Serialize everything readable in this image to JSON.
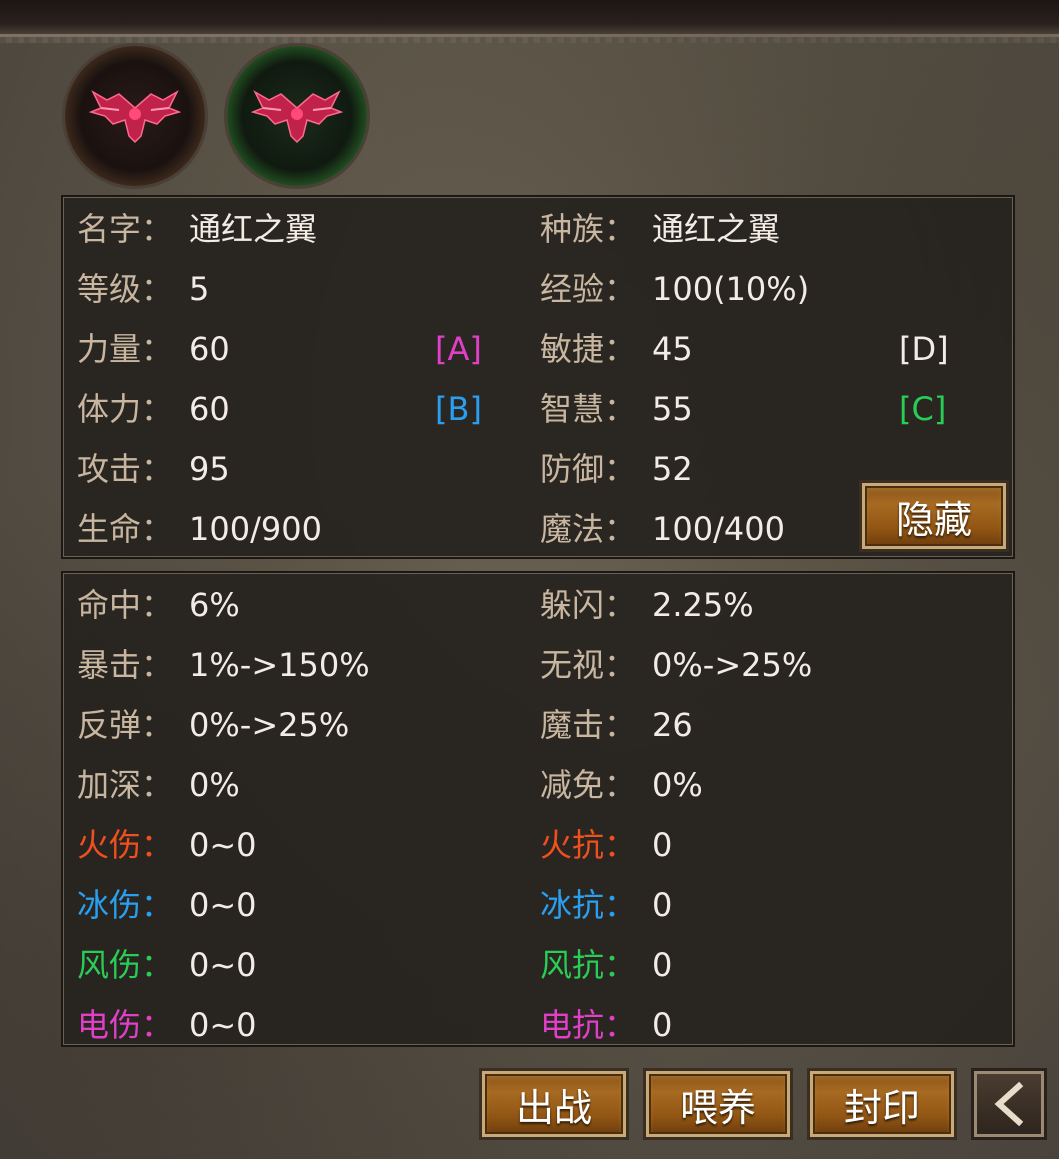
{
  "pets": [
    {
      "slot": "avatar-1",
      "ring_color": "#c6a27a"
    },
    {
      "slot": "avatar-2",
      "ring_color": "#3aa03a"
    }
  ],
  "basic_stats": {
    "name": {
      "label": "名字：",
      "value": "通红之翼"
    },
    "race": {
      "label": "种族：",
      "value": "通红之翼"
    },
    "level": {
      "label": "等级：",
      "value": "5"
    },
    "exp": {
      "label": "经验：",
      "value": "100(10%)"
    },
    "strength": {
      "label": "力量：",
      "value": "60",
      "grade": "[A]"
    },
    "agility": {
      "label": "敏捷：",
      "value": "45",
      "grade": "[D]"
    },
    "stamina": {
      "label": "体力：",
      "value": "60",
      "grade": "[B]"
    },
    "wisdom": {
      "label": "智慧：",
      "value": "55",
      "grade": "[C]"
    },
    "attack": {
      "label": "攻击：",
      "value": "95"
    },
    "defense": {
      "label": "防御：",
      "value": "52"
    },
    "hp": {
      "label": "生命：",
      "value": "100/900"
    },
    "mp": {
      "label": "魔法：",
      "value": "100/400"
    }
  },
  "hide_button": "隐藏",
  "adv_stats": {
    "hit": {
      "label": "命中：",
      "value": "6%"
    },
    "dodge": {
      "label": "躲闪：",
      "value": "2.25%"
    },
    "crit": {
      "label": "暴击：",
      "value": "1%->150%"
    },
    "ignore": {
      "label": "无视：",
      "value": "0%->25%"
    },
    "reflect": {
      "label": "反弹：",
      "value": "0%->25%"
    },
    "magic_attack": {
      "label": "魔击：",
      "value": "26"
    },
    "deepen": {
      "label": "加深：",
      "value": "0%"
    },
    "reduce": {
      "label": "减免：",
      "value": "0%"
    },
    "fire_dmg": {
      "label": "火伤：",
      "value": "0~0"
    },
    "fire_res": {
      "label": "火抗：",
      "value": "0"
    },
    "ice_dmg": {
      "label": "冰伤：",
      "value": "0~0"
    },
    "ice_res": {
      "label": "冰抗：",
      "value": "0"
    },
    "wind_dmg": {
      "label": "风伤：",
      "value": "0~0"
    },
    "wind_res": {
      "label": "风抗：",
      "value": "0"
    },
    "elec_dmg": {
      "label": "电伤：",
      "value": "0~0"
    },
    "elec_res": {
      "label": "电抗：",
      "value": "0"
    }
  },
  "colors": {
    "fire": "#f0501e",
    "ice": "#2a9ff0",
    "wind": "#29cc55",
    "electric": "#e040c8",
    "label": "#c8b6a0",
    "value": "#f2ece4"
  },
  "actions": {
    "deploy": "出战",
    "feed": "喂养",
    "seal": "封印",
    "back_icon": "chevron-left-icon"
  }
}
